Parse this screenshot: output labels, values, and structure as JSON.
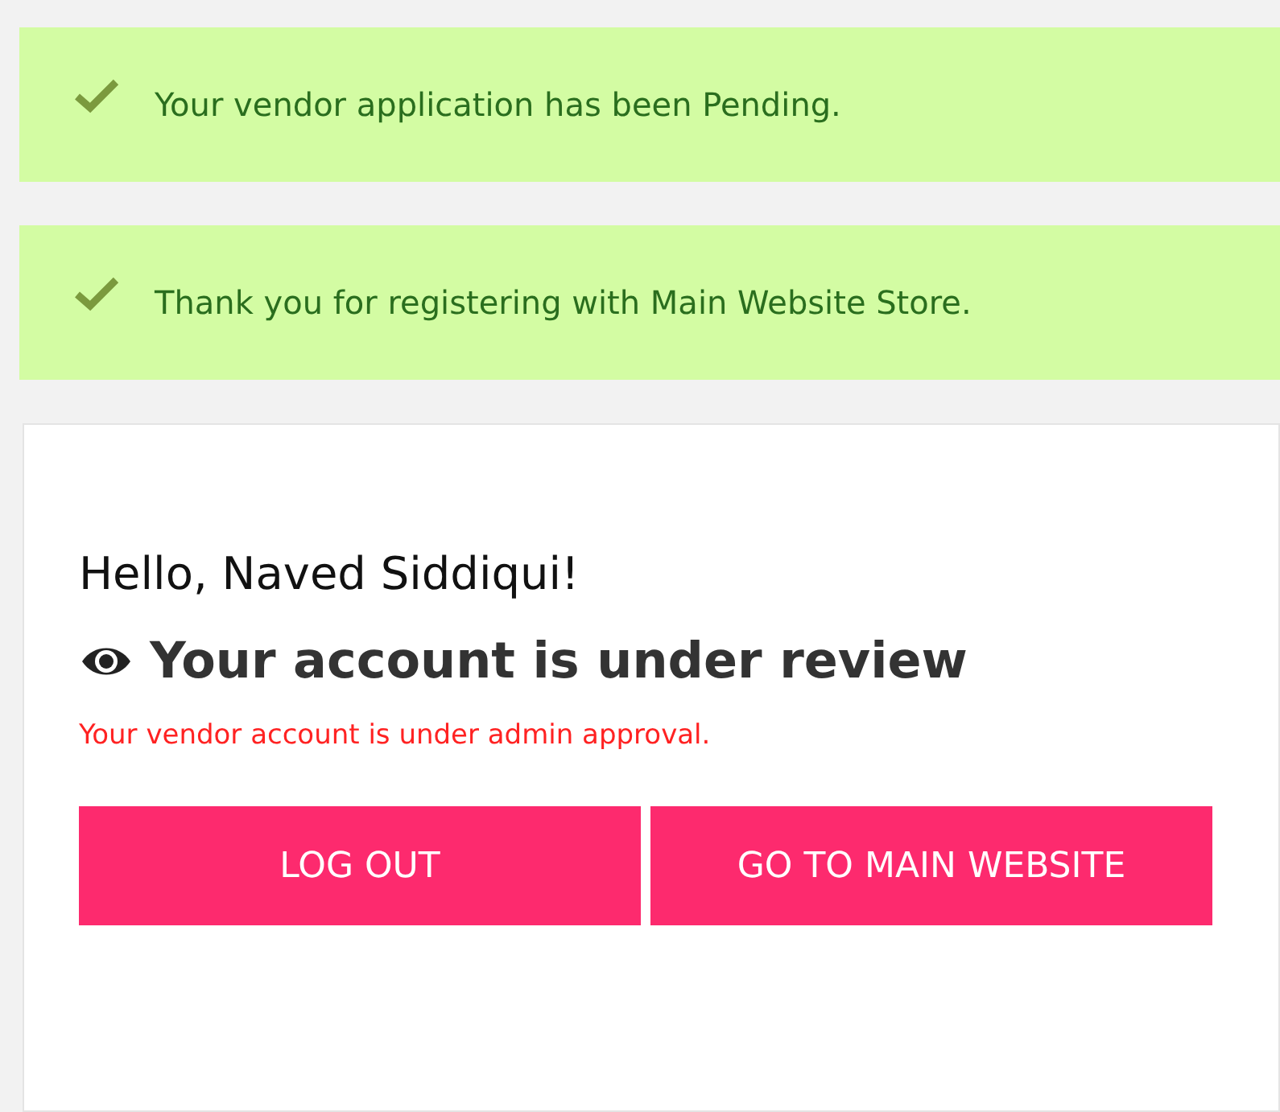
{
  "messages": [
    {
      "kind": "success",
      "text": "Your vendor application has been Pending."
    },
    {
      "kind": "success",
      "text": "Thank you for registering with Main Website Store."
    }
  ],
  "panel": {
    "greeting": "Hello, Naved Siddiqui!",
    "heading": "Your account is under review",
    "notice": "Your vendor account is under admin approval.",
    "buttons": [
      {
        "label": "LOG OUT"
      },
      {
        "label": "GO TO MAIN WEBSITE"
      }
    ]
  }
}
